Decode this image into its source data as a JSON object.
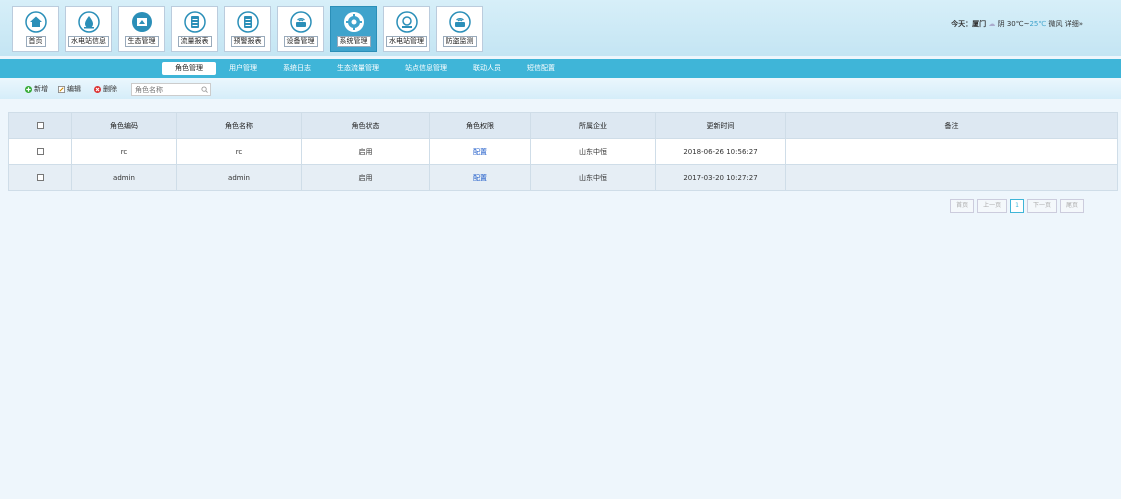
{
  "nav": {
    "tiles": [
      {
        "label": "首页",
        "icon": "home-icon",
        "active": false
      },
      {
        "label": "水电站信息",
        "icon": "hydro-station-icon",
        "active": false
      },
      {
        "label": "生态管理",
        "icon": "ecology-icon",
        "active": false
      },
      {
        "label": "流量报表",
        "icon": "report-icon",
        "active": false
      },
      {
        "label": "预警报表",
        "icon": "warning-report-icon",
        "active": false
      },
      {
        "label": "设备管理",
        "icon": "device-icon",
        "active": false
      },
      {
        "label": "系统管理",
        "icon": "gear-icon",
        "active": true
      },
      {
        "label": "水电站管理",
        "icon": "station-manage-icon",
        "active": false
      },
      {
        "label": "防盗监测",
        "icon": "monitor-icon",
        "active": false
      }
    ]
  },
  "weather": {
    "prefix": "今天：",
    "city": "厦门",
    "desc": "阴 30℃~",
    "temp_hi": "25℃",
    "wind": "微风",
    "details": "详细»"
  },
  "subnav": {
    "items": [
      "角色管理",
      "用户管理",
      "系统日志",
      "生态流量管理",
      "站点信息管理",
      "联动人员",
      "短信配置"
    ],
    "active_index": 0
  },
  "toolbar": {
    "add": "新增",
    "edit": "编辑",
    "delete": "删除",
    "search_placeholder": "角色名称"
  },
  "table": {
    "headers": [
      "",
      "角色编码",
      "角色名称",
      "角色状态",
      "角色权限",
      "所属企业",
      "更新时间",
      "备注"
    ],
    "rows": [
      {
        "code": "rc",
        "name": "rc",
        "status": "启用",
        "perm": "配置",
        "company": "山东中恒",
        "updated": "2018-06-26 10:56:27",
        "note": ""
      },
      {
        "code": "admin",
        "name": "admin",
        "status": "启用",
        "perm": "配置",
        "company": "山东中恒",
        "updated": "2017-03-20 10:27:27",
        "note": ""
      }
    ]
  },
  "pager": {
    "first": "首页",
    "prev": "上一页",
    "current": "1",
    "next": "下一页",
    "last": "尾页"
  },
  "colors": {
    "accent": "#3fb5d8",
    "active_tile": "#3fa3cc",
    "link": "#1a58c8"
  }
}
